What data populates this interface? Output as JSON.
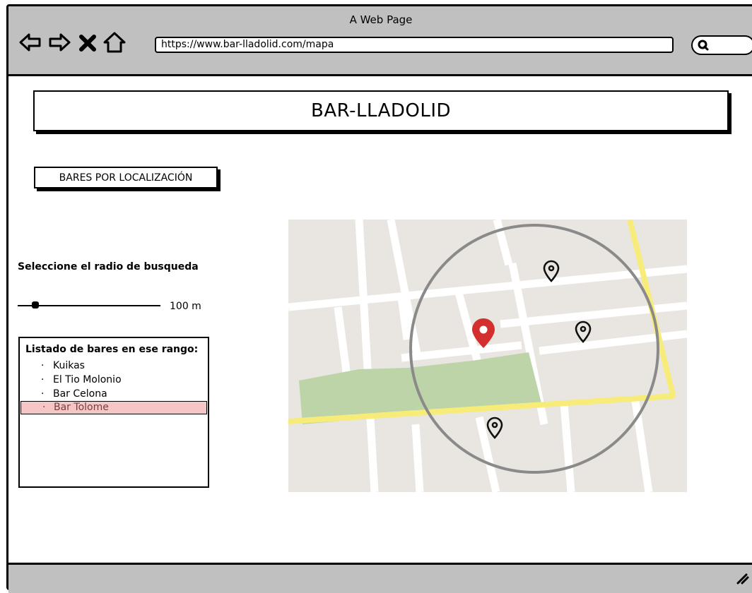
{
  "browser": {
    "window_title": "A Web Page",
    "url": "https://www.bar-lladolid.com/mapa",
    "nav_icons": [
      "back-arrow-icon",
      "forward-arrow-icon",
      "stop-x-icon",
      "home-icon"
    ],
    "search_icon": "search-icon"
  },
  "header": {
    "title": "BAR-LLADOLID"
  },
  "filters": {
    "location_button_label": "BARES POR LOCALIZACIÓN"
  },
  "radius": {
    "label": "Seleccione el radio de busqueda",
    "value_text": "100 m",
    "slider_fraction": 0.1
  },
  "bar_list": {
    "title": "Listado de bares en ese rango:",
    "bullet": "·",
    "items": [
      {
        "name": "Kuikas",
        "selected": false
      },
      {
        "name": "El Tio Molonio",
        "selected": false
      },
      {
        "name": "Bar Celona",
        "selected": false
      },
      {
        "name": "Bar Tolome",
        "selected": true
      }
    ]
  },
  "map": {
    "colors": {
      "block": "#e9e6e1",
      "street": "#ffffff",
      "main_road": "#f7ec7a",
      "park": "#bcd4a8",
      "search_circle": "#8a8a8a",
      "user_pin": "#d32f2f",
      "bar_pin": "#111111"
    },
    "user_pin_icon": "location-pin-icon",
    "bar_pin_icon": "map-marker-outline-icon"
  }
}
